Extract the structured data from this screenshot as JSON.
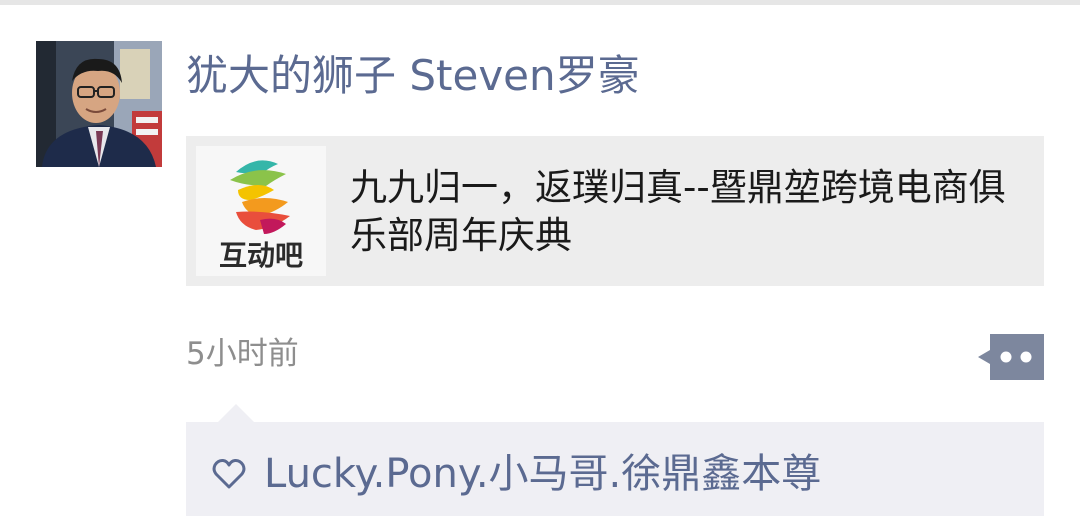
{
  "post": {
    "author_name": "犹大的狮子 Steven罗豪",
    "avatar_icon": "profile-photo",
    "shared_link": {
      "thumbnail_icon": "hudongba-logo-icon",
      "thumbnail_caption": "互动吧",
      "title": "九九归一，返璞归真--暨鼎堃跨境电商俱乐部周年庆典"
    },
    "timestamp": "5小时前",
    "more_icon": "more-dots-icon"
  },
  "likes": {
    "icon": "heart-outline-icon",
    "names": "Lucky.Pony.小马哥.徐鼎鑫本尊"
  },
  "colors": {
    "name_link": "#5b6a91",
    "card_background": "#ededed",
    "likes_background": "#efeff4",
    "timestamp": "#8e8e8e"
  }
}
